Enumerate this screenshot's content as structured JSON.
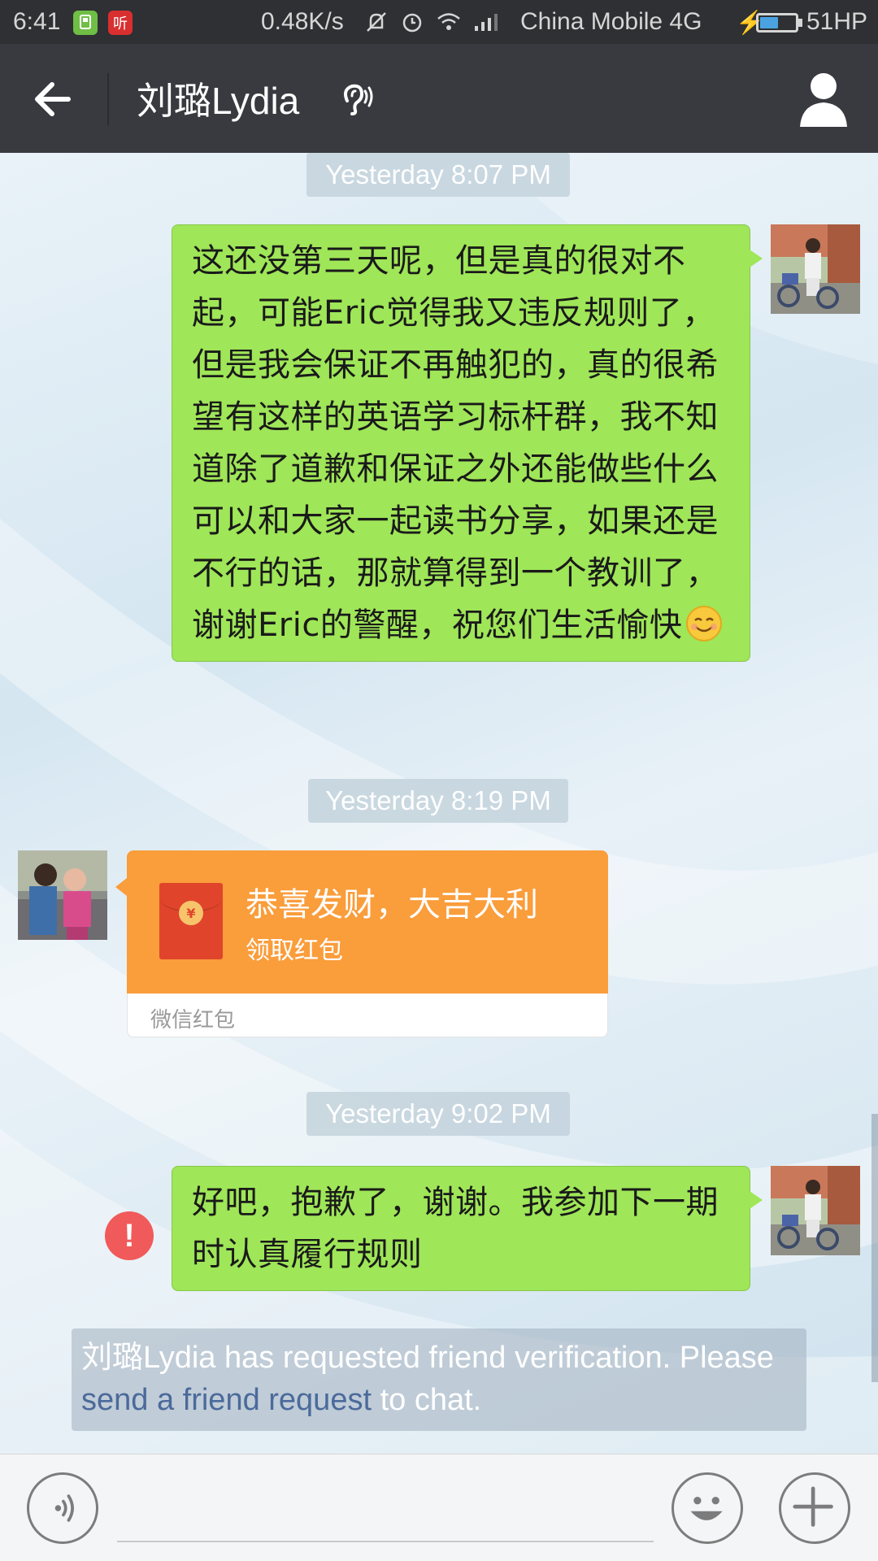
{
  "status_bar": {
    "time": "6:41",
    "app_icon_1": "phone-app-icon",
    "app_icon_2": "听",
    "network_speed": "0.48K/s",
    "carrier": "China Mobile 4G",
    "battery_text": "51HP",
    "battery_level": 0.51
  },
  "header": {
    "title": "刘璐Lydia",
    "back_icon": "arrow-left-icon",
    "earpiece_icon": "ear-icon",
    "profile_icon": "person-icon"
  },
  "messages": [
    {
      "type": "timestamp",
      "text": "Yesterday 8:07 PM"
    },
    {
      "type": "text",
      "direction": "outgoing",
      "text": "这还没第三天呢，但是真的很对不起，可能Eric觉得我又违反规则了，但是我会保证不再触犯的，真的很希望有这样的英语学习标杆群，我不知道除了道歉和保证之外还能做些什么可以和大家一起读书分享，如果还是不行的话，那就算得到一个教训了，谢谢Eric的警醒，祝您们生活愉快",
      "emoji": "smiling-face-emoji"
    },
    {
      "type": "timestamp",
      "text": "Yesterday 8:19 PM"
    },
    {
      "type": "red_packet",
      "direction": "incoming",
      "greeting": "恭喜发财，大吉大利",
      "action": "领取红包",
      "label": "微信红包"
    },
    {
      "type": "timestamp",
      "text": "Yesterday 9:02 PM"
    },
    {
      "type": "text",
      "direction": "outgoing",
      "status": "failed",
      "text": "好吧，抱歉了，谢谢。我参加下一期时认真履行规则"
    }
  ],
  "system_notice": {
    "prefix": "刘璐Lydia has requested friend verification. Please ",
    "link": "send a friend request",
    "suffix": " to chat."
  },
  "input_bar": {
    "placeholder": "",
    "voice_icon": "voice-icon",
    "emoji_icon": "emoji-icon",
    "plus_icon": "plus-icon"
  },
  "colors": {
    "outgoing_bubble": "#9fe658",
    "red_packet": "#fa9d3b",
    "header_bg": "#393a3f",
    "error": "#f15a5a",
    "link": "#4b6a9b"
  }
}
